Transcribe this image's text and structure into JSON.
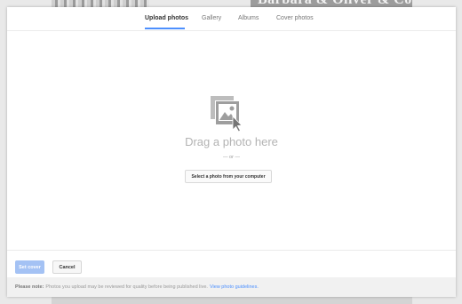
{
  "background": {
    "brand_text": "Barbara & Oliver & Co."
  },
  "tabs": [
    {
      "label": "Upload photos",
      "active": true
    },
    {
      "label": "Gallery",
      "active": false
    },
    {
      "label": "Albums",
      "active": false
    },
    {
      "label": "Cover photos",
      "active": false
    }
  ],
  "drop_zone": {
    "icon": "photo-drag-icon",
    "title": "Drag a photo here",
    "or_text": "— or —",
    "select_button": "Select a photo from your computer"
  },
  "actions": {
    "set_cover": "Set cover",
    "cancel": "Cancel"
  },
  "note": {
    "label": "Please note:",
    "text": "Photos you upload may be reviewed for quality before being published live.",
    "link": "View photo guidelines."
  },
  "colors": {
    "accent": "#4d90fe",
    "primary_disabled": "#a4c2f4"
  }
}
